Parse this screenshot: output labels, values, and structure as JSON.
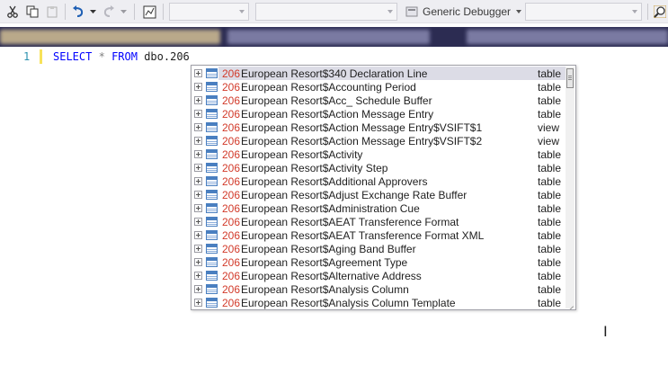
{
  "toolbar": {
    "debugger_label": "Generic Debugger",
    "icons": [
      "scissors-icon",
      "copy-icon",
      "paste-icon",
      "undo-icon",
      "redo-icon",
      "results-icon",
      "search-icon"
    ]
  },
  "editor": {
    "line_number": "1",
    "code": {
      "kw1": "SELECT",
      "star": "*",
      "kw2": "FROM",
      "ident": "dbo.206"
    }
  },
  "completion": {
    "items": [
      {
        "prefix": "206",
        "name": "European Resort$340 Declaration Line",
        "type": "table",
        "selected": true
      },
      {
        "prefix": "206",
        "name": "European Resort$Accounting Period",
        "type": "table"
      },
      {
        "prefix": "206",
        "name": "European Resort$Acc_ Schedule Buffer",
        "type": "table"
      },
      {
        "prefix": "206",
        "name": "European Resort$Action Message Entry",
        "type": "table"
      },
      {
        "prefix": "206",
        "name": "European Resort$Action Message Entry$VSIFT$1",
        "type": "view"
      },
      {
        "prefix": "206",
        "name": "European Resort$Action Message Entry$VSIFT$2",
        "type": "view"
      },
      {
        "prefix": "206",
        "name": "European Resort$Activity",
        "type": "table"
      },
      {
        "prefix": "206",
        "name": "European Resort$Activity Step",
        "type": "table"
      },
      {
        "prefix": "206",
        "name": "European Resort$Additional Approvers",
        "type": "table"
      },
      {
        "prefix": "206",
        "name": "European Resort$Adjust Exchange Rate Buffer",
        "type": "table"
      },
      {
        "prefix": "206",
        "name": "European Resort$Administration Cue",
        "type": "table"
      },
      {
        "prefix": "206",
        "name": "European Resort$AEAT Transference Format",
        "type": "table"
      },
      {
        "prefix": "206",
        "name": "European Resort$AEAT Transference Format XML",
        "type": "table"
      },
      {
        "prefix": "206",
        "name": "European Resort$Aging Band Buffer",
        "type": "table"
      },
      {
        "prefix": "206",
        "name": "European Resort$Agreement Type",
        "type": "table"
      },
      {
        "prefix": "206",
        "name": "European Resort$Alternative Address",
        "type": "table"
      },
      {
        "prefix": "206",
        "name": "European Resort$Analysis Column",
        "type": "table"
      },
      {
        "prefix": "206",
        "name": "European Resort$Analysis Column Template",
        "type": "table"
      }
    ]
  }
}
